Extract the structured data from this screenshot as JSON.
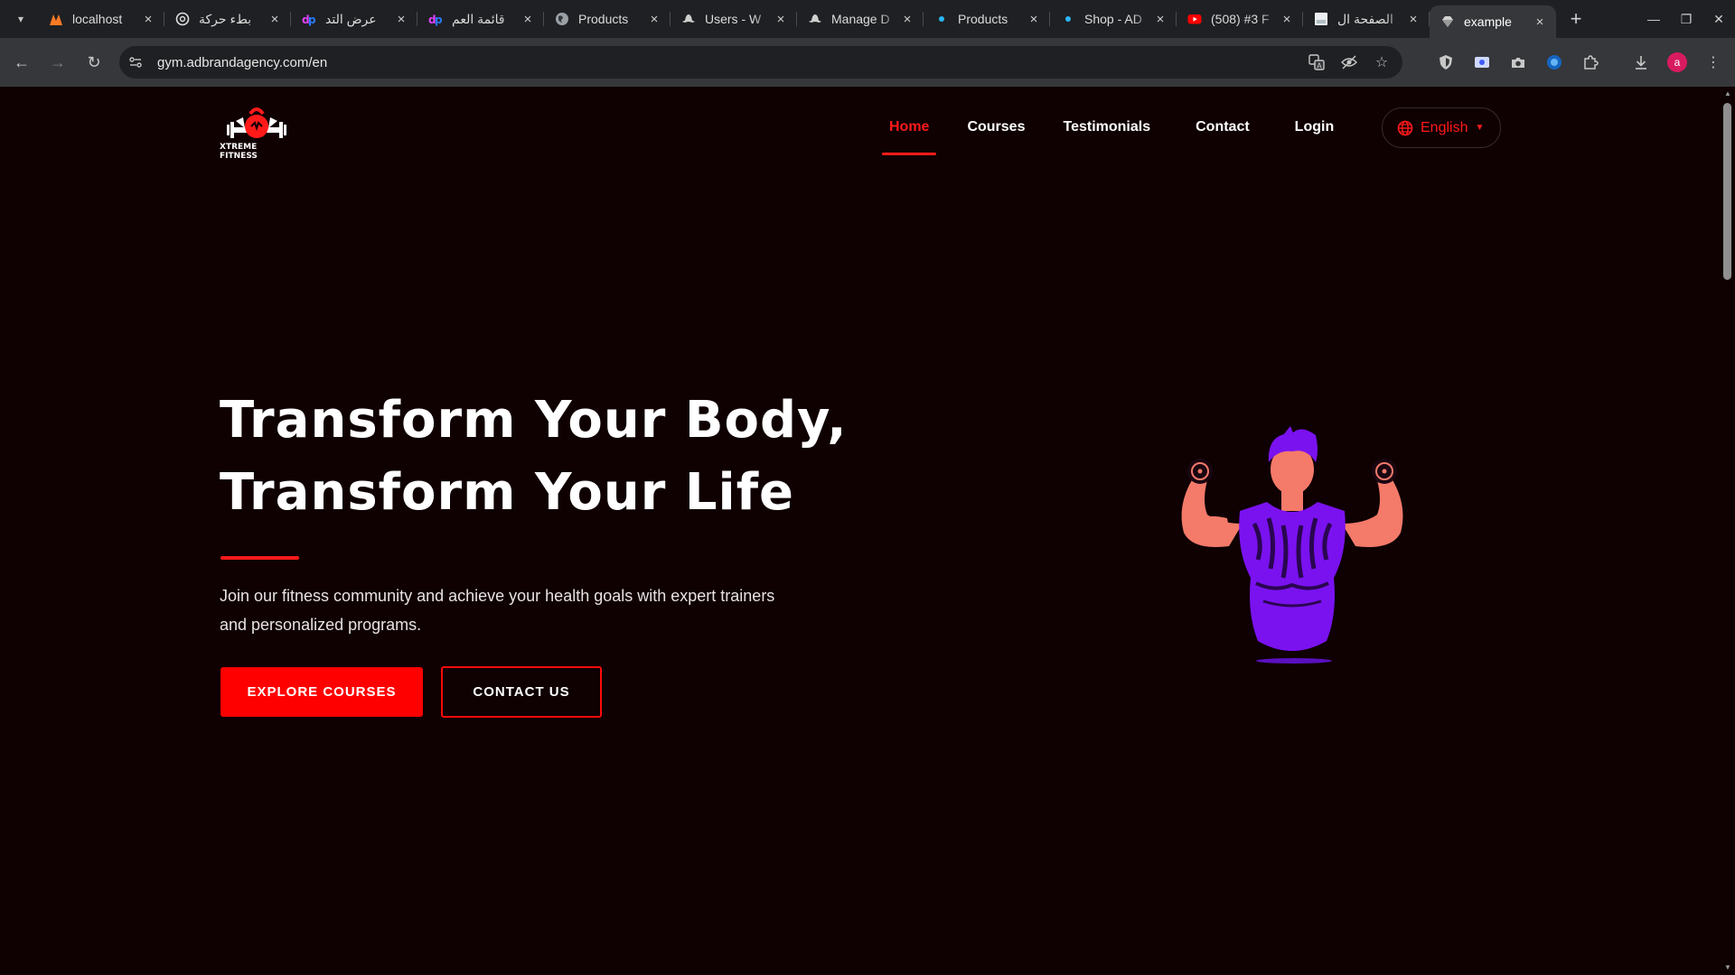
{
  "browser": {
    "tabs": [
      {
        "title": "localhost",
        "favicon": "xampp-icon",
        "active": false
      },
      {
        "title": "بطء حركة",
        "favicon": "openai-icon",
        "active": false
      },
      {
        "title": "عرض التد",
        "favicon": "dp-icon",
        "active": false
      },
      {
        "title": "قائمة العم",
        "favicon": "dp-icon",
        "active": false
      },
      {
        "title": "Products",
        "favicon": "globe-icon",
        "active": false
      },
      {
        "title": "Users - W",
        "favicon": "hat-icon",
        "active": false
      },
      {
        "title": "Manage D",
        "favicon": "hat-icon",
        "active": false
      },
      {
        "title": "Products",
        "favicon": "dot-icon",
        "active": false
      },
      {
        "title": "Shop - AD",
        "favicon": "dot-icon",
        "active": false
      },
      {
        "title": "(508) #3 F",
        "favicon": "youtube-icon",
        "active": false
      },
      {
        "title": "الصفحة ال",
        "favicon": "doc-icon",
        "active": false
      },
      {
        "title": "example",
        "favicon": "diamond-icon",
        "active": true
      }
    ],
    "url": "gym.adbrandagency.com/en",
    "profile_initial": "a"
  },
  "site": {
    "logo_text": "XTREME FITNESS",
    "nav": [
      {
        "label": "Home",
        "active": true
      },
      {
        "label": "Courses",
        "active": false
      },
      {
        "label": "Testimonials",
        "active": false
      },
      {
        "label": "Contact",
        "active": false
      },
      {
        "label": "Login",
        "active": false
      }
    ],
    "language": "English"
  },
  "hero": {
    "title_line1": "Transform Your Body,",
    "title_line2": "Transform Your Life",
    "subtitle": "Join our fitness community and achieve your health goals with expert trainers and personalized programs.",
    "primary_cta": "EXPLORE COURSES",
    "secondary_cta": "CONTACT US"
  },
  "colors": {
    "background": "#0f0002",
    "accent": "#ff0000",
    "illustration_purple": "#7a12f0",
    "illustration_skin": "#f47a6a"
  }
}
